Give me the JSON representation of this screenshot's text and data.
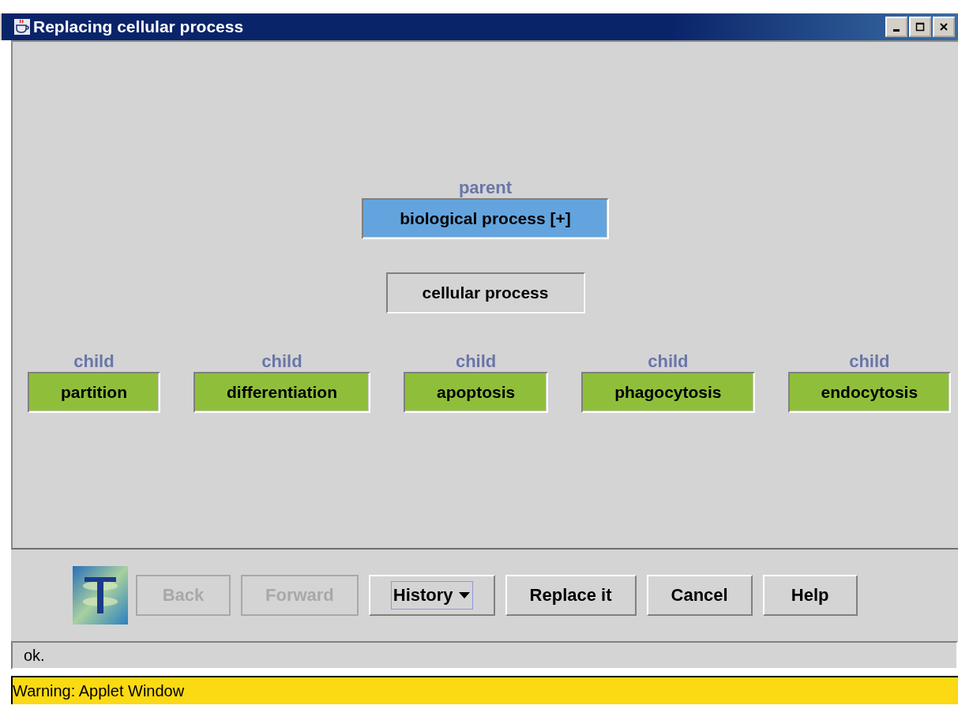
{
  "window": {
    "title": "Replacing cellular process"
  },
  "graph": {
    "parent": {
      "relation": "parent",
      "label": "biological process [+]"
    },
    "current": {
      "label": "cellular process"
    },
    "children": [
      {
        "relation": "child",
        "label": "partition"
      },
      {
        "relation": "child",
        "label": "differentiation"
      },
      {
        "relation": "child",
        "label": "apoptosis"
      },
      {
        "relation": "child",
        "label": "phagocytosis"
      },
      {
        "relation": "child",
        "label": "endocytosis"
      }
    ]
  },
  "buttons": [
    {
      "label": "Back",
      "kind": "push",
      "disabled": true,
      "focused": false
    },
    {
      "label": "Forward",
      "kind": "push",
      "disabled": true,
      "focused": false
    },
    {
      "label": "History",
      "kind": "dropdown",
      "disabled": false,
      "focused": true
    },
    {
      "label": "Replace it",
      "kind": "push",
      "disabled": false,
      "focused": false
    },
    {
      "label": "Cancel",
      "kind": "push",
      "disabled": false,
      "focused": false
    },
    {
      "label": "Help",
      "kind": "push",
      "disabled": false,
      "focused": false
    }
  ],
  "status_bar": "ok.",
  "warning": "Warning: Applet Window"
}
